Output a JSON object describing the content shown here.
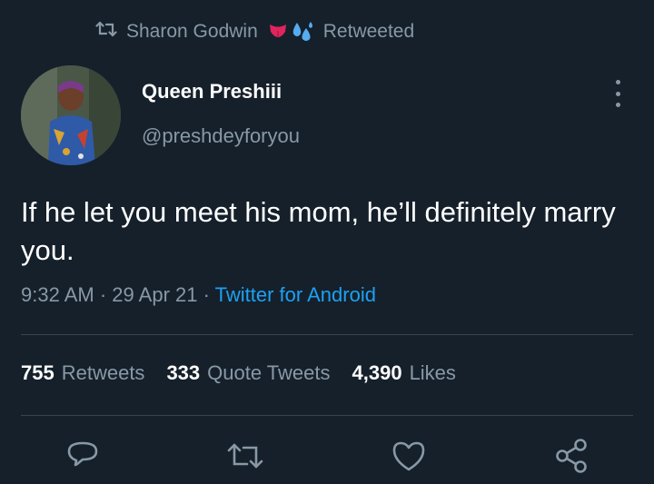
{
  "retweet": {
    "icon": "retweet-icon",
    "user": "Sharon Godwin",
    "emojis": [
      "tongue-emoji",
      "sweat-droplets-emoji"
    ],
    "label": "Retweeted"
  },
  "author": {
    "display_name": "Queen Preshiii",
    "handle": "@preshdeyforyou",
    "avatar": "profile-photo"
  },
  "tweet": {
    "text": "If he let you meet his mom, he’ll definitely marry you.",
    "time": "9:32 AM",
    "date": "29 Apr 21",
    "source": "Twitter for Android"
  },
  "stats": {
    "retweets_count": "755",
    "retweets_label": "Retweets",
    "quotes_count": "333",
    "quotes_label": "Quote Tweets",
    "likes_count": "4,390",
    "likes_label": "Likes"
  },
  "actions": [
    "reply-icon",
    "retweet-icon",
    "like-icon",
    "share-icon"
  ],
  "colors": {
    "background": "#15202b",
    "secondary_text": "#8899a6",
    "link": "#1da1f2",
    "divider": "#38444d"
  }
}
